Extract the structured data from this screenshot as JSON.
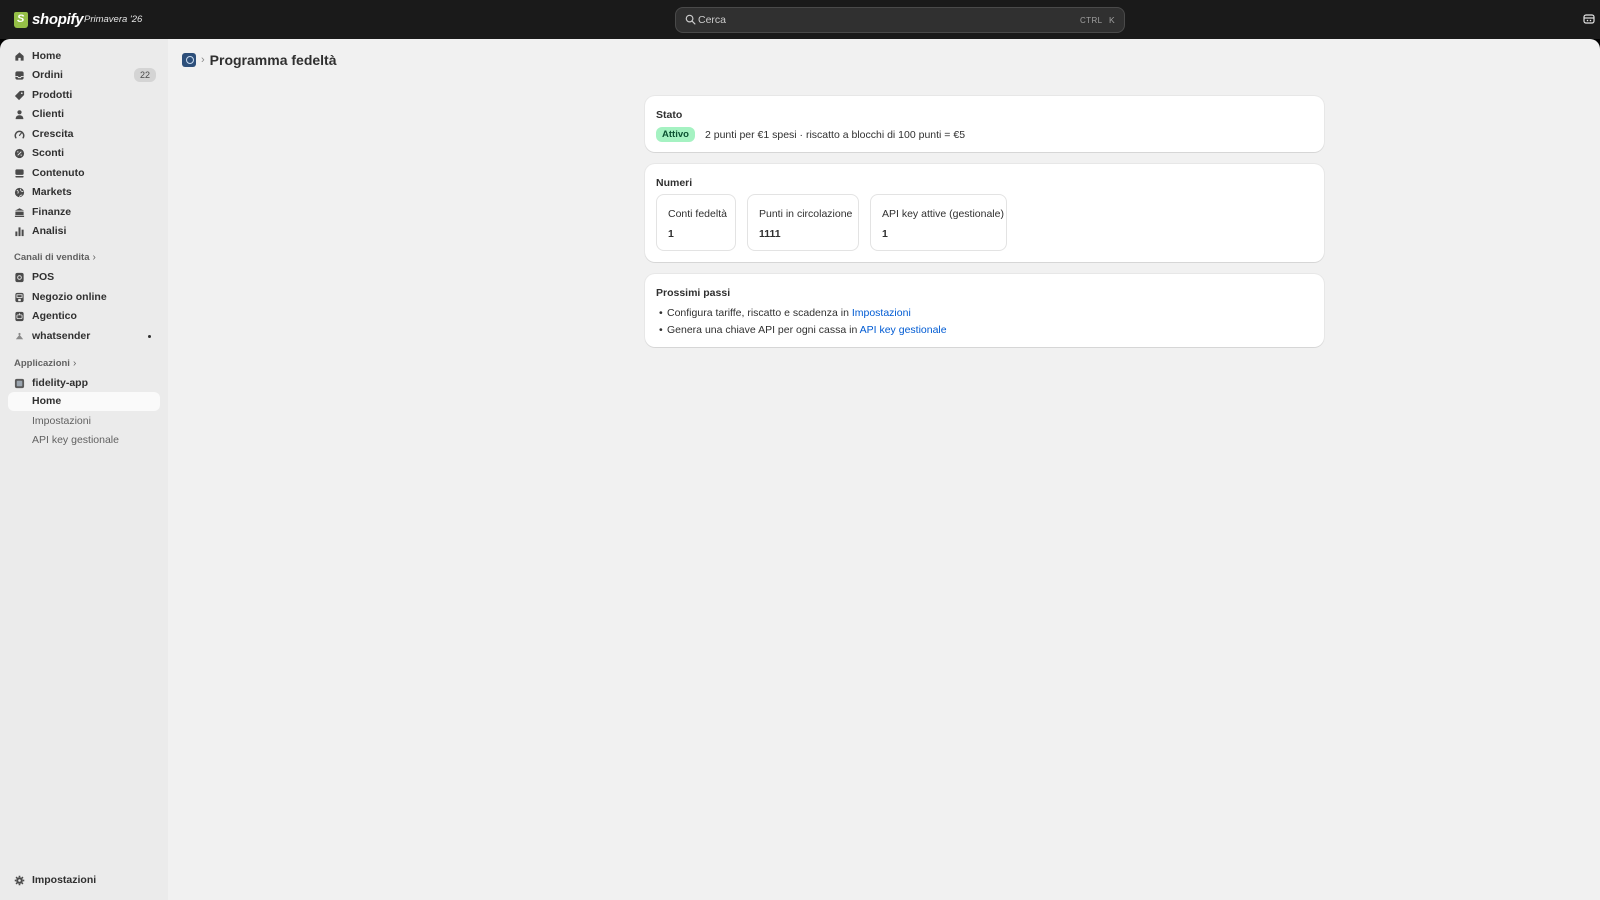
{
  "topbar": {
    "brand": "shopify",
    "edition": "Primavera '26",
    "search_placeholder": "Cerca",
    "shortcut_modifier": "CTRL",
    "shortcut_key": "K"
  },
  "sidebar": {
    "items": [
      {
        "label": "Home",
        "icon": "home-icon"
      },
      {
        "label": "Ordini",
        "icon": "inbox-icon",
        "badge": "22"
      },
      {
        "label": "Prodotti",
        "icon": "tag-icon"
      },
      {
        "label": "Clienti",
        "icon": "person-icon"
      },
      {
        "label": "Crescita",
        "icon": "gauge-icon"
      },
      {
        "label": "Sconti",
        "icon": "discount-icon"
      },
      {
        "label": "Contenuto",
        "icon": "content-icon"
      },
      {
        "label": "Markets",
        "icon": "globe-icon"
      },
      {
        "label": "Finanze",
        "icon": "bank-icon"
      },
      {
        "label": "Analisi",
        "icon": "bar-chart-icon"
      }
    ],
    "sales_channels_label": "Canali di vendita",
    "sales_channels": [
      {
        "label": "POS",
        "icon": "pos-icon"
      },
      {
        "label": "Negozio online",
        "icon": "store-icon"
      },
      {
        "label": "Agentico",
        "icon": "agent-icon"
      },
      {
        "label": "whatsender",
        "icon": "app-icon"
      }
    ],
    "apps_label": "Applicazioni",
    "app": {
      "label": "fidelity-app"
    },
    "app_subitems": [
      {
        "label": "Home"
      },
      {
        "label": "Impostazioni"
      },
      {
        "label": "API key gestionale"
      }
    ],
    "settings_label": "Impostazioni"
  },
  "page": {
    "title": "Programma fedeltà"
  },
  "status_card": {
    "title": "Stato",
    "badge": "Attivo",
    "description": "2 punti per €1 spesi · riscatto a blocchi di 100 punti = €5"
  },
  "numbers_card": {
    "title": "Numeri",
    "metrics": [
      {
        "label": "Conti fedeltà",
        "value": "1"
      },
      {
        "label": "Punti in circolazione",
        "value": "1111"
      },
      {
        "label": "API key attive (gestionale)",
        "value": "1"
      }
    ]
  },
  "next_steps_card": {
    "title": "Prossimi passi",
    "steps": [
      {
        "text": "Configura tariffe, riscatto e scadenza in ",
        "link": "Impostazioni"
      },
      {
        "text": "Genera una chiave API per ogni cassa in ",
        "link": "API key gestionale"
      }
    ]
  },
  "colors": {
    "topbar": "#1a1a1a",
    "sidebar": "#ebebeb",
    "main": "#f1f1f1",
    "success_badge": "#a5f2c2",
    "link": "#005bd3"
  }
}
